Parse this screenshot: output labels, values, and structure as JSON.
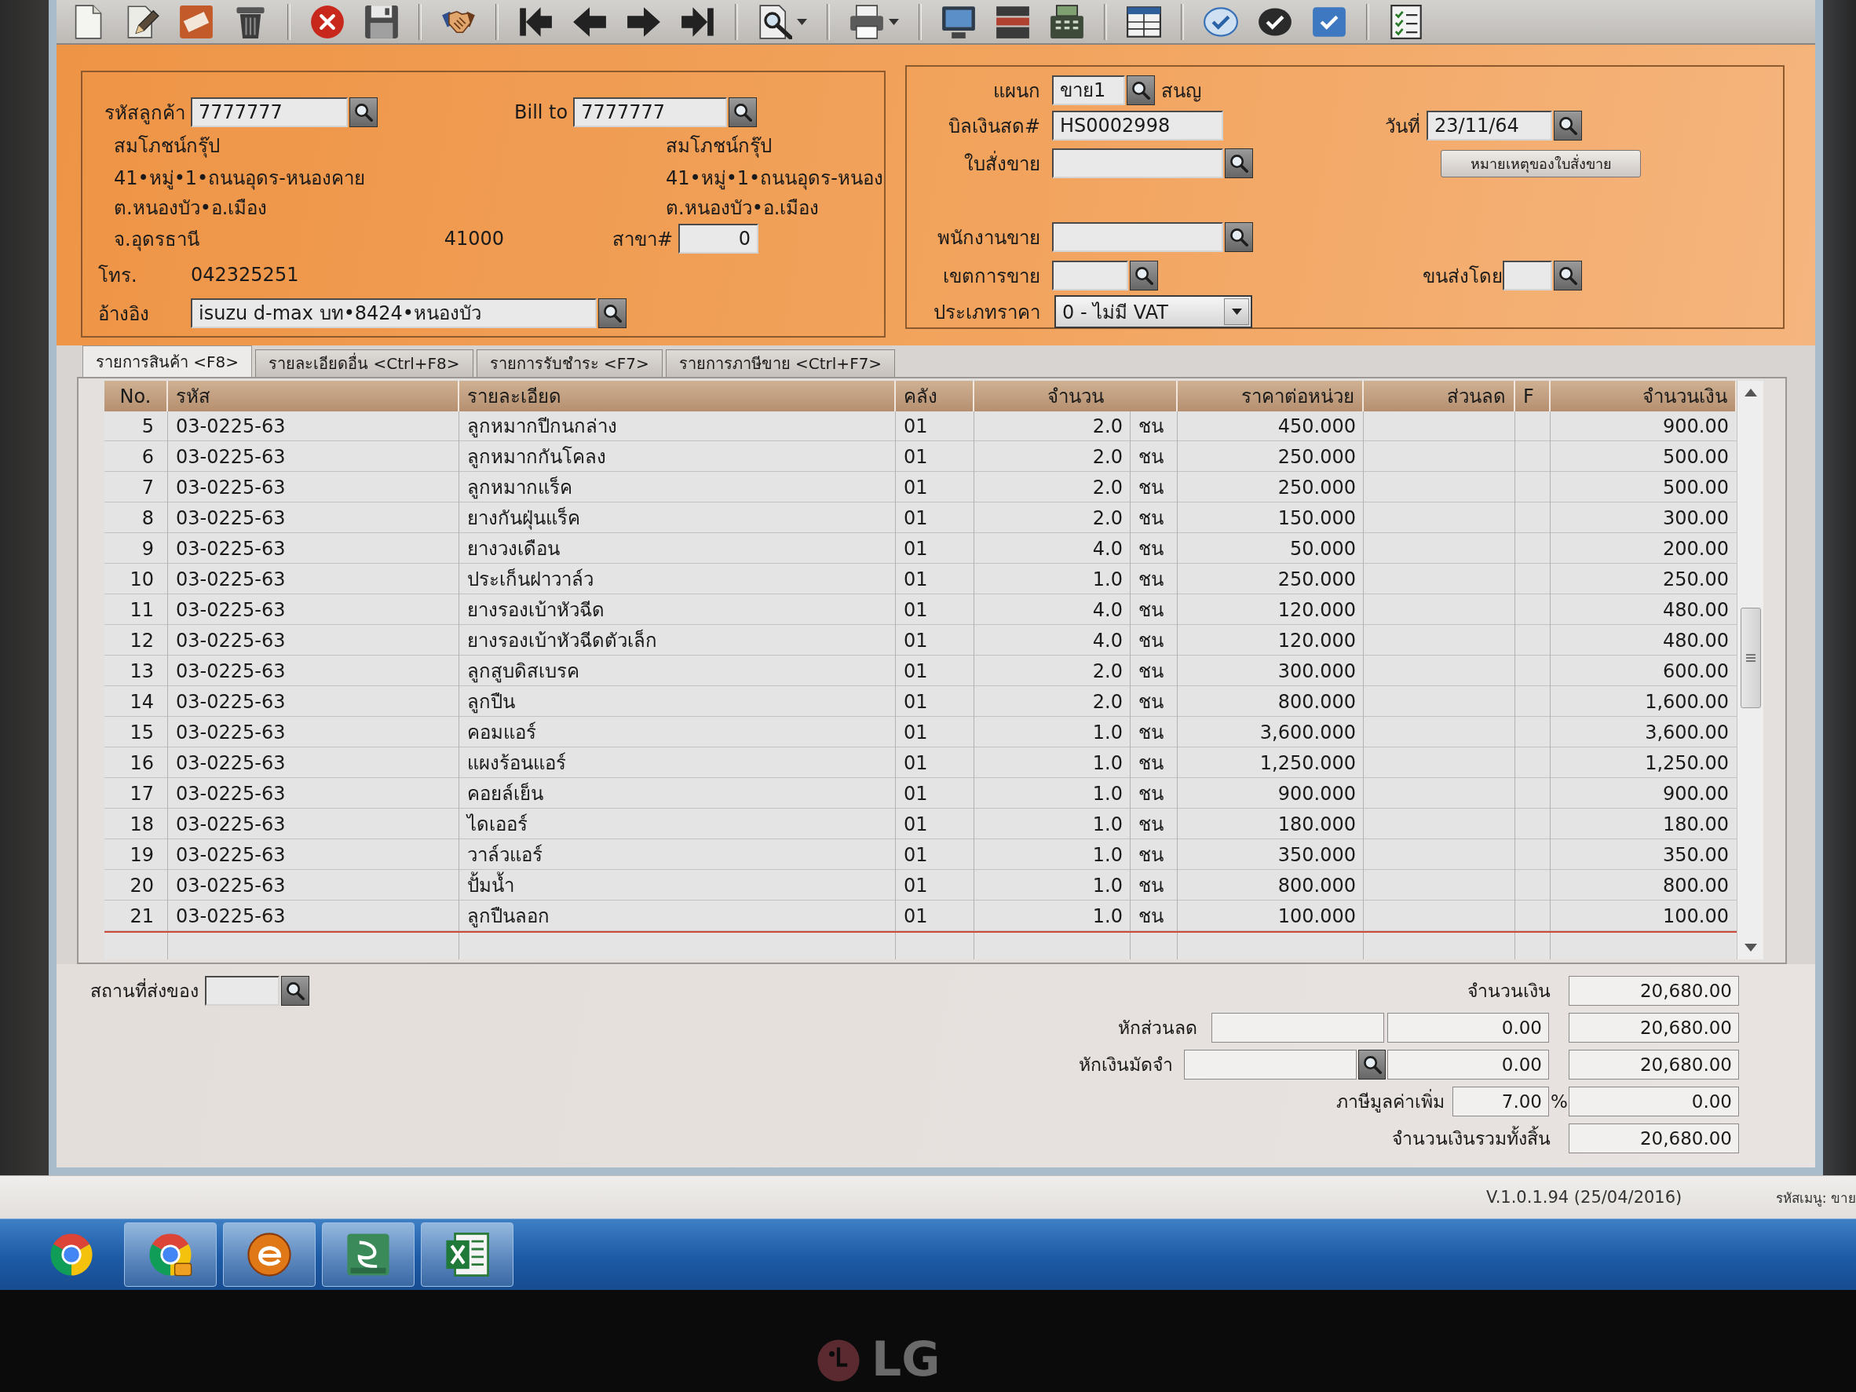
{
  "customer": {
    "code_label": "รหัสลูกค้า",
    "code": "7777777",
    "name": "สมโภชน์กรุ๊ป",
    "address": [
      "41•หมู่•1•ถนนอุดร-หนองคาย",
      "ต.หนองบัว•อ.เมือง"
    ],
    "province": "จ.อุดรธานี",
    "postcode": "41000",
    "phone_label": "โทร.",
    "phone": "042325251",
    "reference_label": "อ้างอิง",
    "reference": "isuzu d-max บท•8424•หนองบัว"
  },
  "bill_to": {
    "label": "Bill to",
    "code": "7777777",
    "name": "สมโภชน์กรุ๊ป",
    "address": [
      "41•หมู่•1•ถนนอุดร-หนอง",
      "ต.หนองบัว•อ.เมือง"
    ],
    "branch_label": "สาขา#",
    "branch": "0"
  },
  "document": {
    "department_label": "แผนก",
    "department": "ขาย1",
    "department_name": "สนญ",
    "cash_bill_label": "บิลเงินสด#",
    "cash_bill": "HS0002998",
    "date_label": "วันที่",
    "date": "23/11/64",
    "sales_order_label": "ใบสั่งขาย",
    "order_note_button": "หมายเหตุของใบสั่งขาย",
    "salesperson_label": "พนักงานขาย",
    "sales_area_label": "เขตการขาย",
    "shipped_by_label": "ขนส่งโดย",
    "price_type_label": "ประเภทราคา",
    "price_type": "0 - ไม่มี VAT"
  },
  "tabs": [
    {
      "label": "รายการสินค้า <F8>",
      "selected": true
    },
    {
      "label": "รายละเอียดอื่น <Ctrl+F8>",
      "selected": false
    },
    {
      "label": "รายการรับชำระ <F7>",
      "selected": false
    },
    {
      "label": "รายการภาษีขาย <Ctrl+F7>",
      "selected": false
    }
  ],
  "table": {
    "columns": [
      "No.",
      "รหัส",
      "รายละเอียด",
      "คลัง",
      "จำนวน",
      "ราคาต่อหน่วย",
      "ส่วนลด",
      "F",
      "จำนวนเงิน"
    ],
    "rows": [
      {
        "no": "5",
        "code": "03-0225-63",
        "description": "ลูกหมากปีกนกล่าง",
        "warehouse": "01",
        "quantity": "2.0",
        "unit": "ชน",
        "unit_price": "450.000",
        "amount": "900.00"
      },
      {
        "no": "6",
        "code": "03-0225-63",
        "description": "ลูกหมากกันโคลง",
        "warehouse": "01",
        "quantity": "2.0",
        "unit": "ชน",
        "unit_price": "250.000",
        "amount": "500.00"
      },
      {
        "no": "7",
        "code": "03-0225-63",
        "description": "ลูกหมากแร็ค",
        "warehouse": "01",
        "quantity": "2.0",
        "unit": "ชน",
        "unit_price": "250.000",
        "amount": "500.00"
      },
      {
        "no": "8",
        "code": "03-0225-63",
        "description": "ยางกันฝุ่นแร็ค",
        "warehouse": "01",
        "quantity": "2.0",
        "unit": "ชน",
        "unit_price": "150.000",
        "amount": "300.00"
      },
      {
        "no": "9",
        "code": "03-0225-63",
        "description": "ยางวงเดือน",
        "warehouse": "01",
        "quantity": "4.0",
        "unit": "ชน",
        "unit_price": "50.000",
        "amount": "200.00"
      },
      {
        "no": "10",
        "code": "03-0225-63",
        "description": "ประเก็นฝาวาล์ว",
        "warehouse": "01",
        "quantity": "1.0",
        "unit": "ชน",
        "unit_price": "250.000",
        "amount": "250.00"
      },
      {
        "no": "11",
        "code": "03-0225-63",
        "description": "ยางรองเบ้าหัวฉีด",
        "warehouse": "01",
        "quantity": "4.0",
        "unit": "ชน",
        "unit_price": "120.000",
        "amount": "480.00"
      },
      {
        "no": "12",
        "code": "03-0225-63",
        "description": "ยางรองเบ้าหัวฉีดตัวเล็ก",
        "warehouse": "01",
        "quantity": "4.0",
        "unit": "ชน",
        "unit_price": "120.000",
        "amount": "480.00"
      },
      {
        "no": "13",
        "code": "03-0225-63",
        "description": "ลูกสูบดิสเบรค",
        "warehouse": "01",
        "quantity": "2.0",
        "unit": "ชน",
        "unit_price": "300.000",
        "amount": "600.00"
      },
      {
        "no": "14",
        "code": "03-0225-63",
        "description": "ลูกปืน",
        "warehouse": "01",
        "quantity": "2.0",
        "unit": "ชน",
        "unit_price": "800.000",
        "amount": "1,600.00"
      },
      {
        "no": "15",
        "code": "03-0225-63",
        "description": "คอมแอร์",
        "warehouse": "01",
        "quantity": "1.0",
        "unit": "ชน",
        "unit_price": "3,600.000",
        "amount": "3,600.00"
      },
      {
        "no": "16",
        "code": "03-0225-63",
        "description": "แผงร้อนแอร์",
        "warehouse": "01",
        "quantity": "1.0",
        "unit": "ชน",
        "unit_price": "1,250.000",
        "amount": "1,250.00"
      },
      {
        "no": "17",
        "code": "03-0225-63",
        "description": "คอยล์เย็น",
        "warehouse": "01",
        "quantity": "1.0",
        "unit": "ชน",
        "unit_price": "900.000",
        "amount": "900.00"
      },
      {
        "no": "18",
        "code": "03-0225-63",
        "description": "ไดเออร์",
        "warehouse": "01",
        "quantity": "1.0",
        "unit": "ชน",
        "unit_price": "180.000",
        "amount": "180.00"
      },
      {
        "no": "19",
        "code": "03-0225-63",
        "description": "วาล์วแอร์",
        "warehouse": "01",
        "quantity": "1.0",
        "unit": "ชน",
        "unit_price": "350.000",
        "amount": "350.00"
      },
      {
        "no": "20",
        "code": "03-0225-63",
        "description": "ปั้มน้ำ",
        "warehouse": "01",
        "quantity": "1.0",
        "unit": "ชน",
        "unit_price": "800.000",
        "amount": "800.00"
      },
      {
        "no": "21",
        "code": "03-0225-63",
        "description": "ลูกปืนลอก",
        "warehouse": "01",
        "quantity": "1.0",
        "unit": "ชน",
        "unit_price": "100.000",
        "amount": "100.00"
      }
    ]
  },
  "summary": {
    "delivery_place_label": "สถานที่ส่งของ",
    "amount_label": "จำนวนเงิน",
    "amount": "20,680.00",
    "discount_label": "หักส่วนลด",
    "discount": "0.00",
    "after_discount": "20,680.00",
    "deposit_label": "หักเงินมัดจำ",
    "deposit": "0.00",
    "after_deposit": "20,680.00",
    "vat_label": "ภาษีมูลค่าเพิ่ม",
    "vat_rate": "7.00",
    "vat_rate_unit": "%",
    "vat": "0.00",
    "grand_total_label": "จำนวนเงินรวมทั้งสิ้น",
    "grand_total": "20,680.00"
  },
  "status_bar": {
    "version": "V.1.0.1.94 (25/04/2016)",
    "menu_code": "รหัสเมนู: ขาย"
  },
  "monitor": {
    "brand": "LG"
  }
}
